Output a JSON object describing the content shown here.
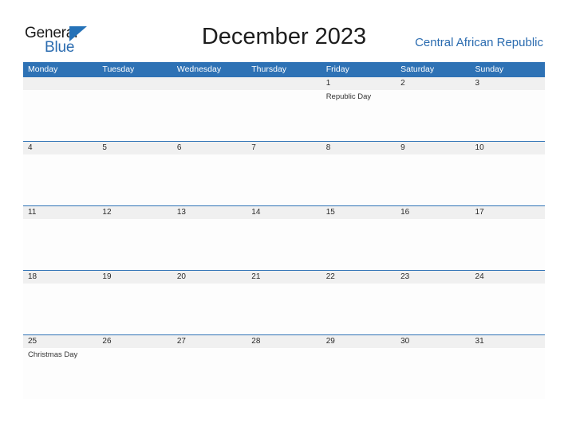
{
  "brand": {
    "name_part1": "General",
    "name_part2": "Blue",
    "triangle_color": "#2572b8",
    "blue_color": "#2b6cb0"
  },
  "header": {
    "title": "December 2023",
    "region": "Central African Republic"
  },
  "theme": {
    "header_bar": "#2e72b5",
    "date_band": "#f0f0f0",
    "row_rule": "#2e72b5",
    "page_background": "#ffffff"
  },
  "calendar": {
    "month": "December",
    "year": "2023",
    "week_start": "Monday",
    "weekdays": [
      "Monday",
      "Tuesday",
      "Wednesday",
      "Thursday",
      "Friday",
      "Saturday",
      "Sunday"
    ],
    "weeks": [
      {
        "days": [
          {
            "date": "",
            "events": []
          },
          {
            "date": "",
            "events": []
          },
          {
            "date": "",
            "events": []
          },
          {
            "date": "",
            "events": []
          },
          {
            "date": "1",
            "events": [
              "Republic Day"
            ]
          },
          {
            "date": "2",
            "events": []
          },
          {
            "date": "3",
            "events": []
          }
        ]
      },
      {
        "days": [
          {
            "date": "4",
            "events": []
          },
          {
            "date": "5",
            "events": []
          },
          {
            "date": "6",
            "events": []
          },
          {
            "date": "7",
            "events": []
          },
          {
            "date": "8",
            "events": []
          },
          {
            "date": "9",
            "events": []
          },
          {
            "date": "10",
            "events": []
          }
        ]
      },
      {
        "days": [
          {
            "date": "11",
            "events": []
          },
          {
            "date": "12",
            "events": []
          },
          {
            "date": "13",
            "events": []
          },
          {
            "date": "14",
            "events": []
          },
          {
            "date": "15",
            "events": []
          },
          {
            "date": "16",
            "events": []
          },
          {
            "date": "17",
            "events": []
          }
        ]
      },
      {
        "days": [
          {
            "date": "18",
            "events": []
          },
          {
            "date": "19",
            "events": []
          },
          {
            "date": "20",
            "events": []
          },
          {
            "date": "21",
            "events": []
          },
          {
            "date": "22",
            "events": []
          },
          {
            "date": "23",
            "events": []
          },
          {
            "date": "24",
            "events": []
          }
        ]
      },
      {
        "days": [
          {
            "date": "25",
            "events": [
              "Christmas Day"
            ]
          },
          {
            "date": "26",
            "events": []
          },
          {
            "date": "27",
            "events": []
          },
          {
            "date": "28",
            "events": []
          },
          {
            "date": "29",
            "events": []
          },
          {
            "date": "30",
            "events": []
          },
          {
            "date": "31",
            "events": []
          }
        ]
      }
    ]
  }
}
